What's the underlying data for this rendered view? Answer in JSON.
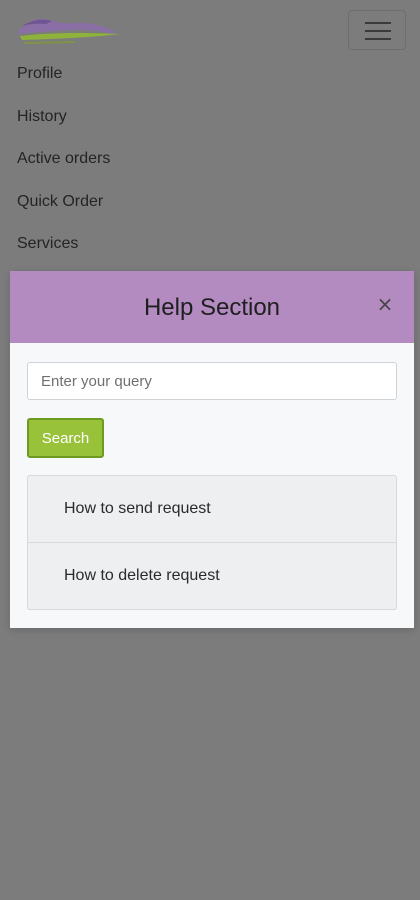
{
  "nav": {
    "items": [
      {
        "label": "Profile"
      },
      {
        "label": "History"
      },
      {
        "label": "Active orders"
      },
      {
        "label": "Quick Order"
      },
      {
        "label": "Services"
      }
    ]
  },
  "modal": {
    "title": "Help Section",
    "close_label": "×",
    "search": {
      "placeholder": "Enter your query",
      "value": "",
      "button_label": "Search"
    },
    "help_items": [
      {
        "label": "How to send request"
      },
      {
        "label": "How to delete request"
      }
    ]
  },
  "colors": {
    "overlay": "#7c7c7c",
    "modal_header": "#b38bc1",
    "search_button": "#99c23b"
  },
  "icons": {
    "logo": "brand-logo",
    "menu": "hamburger-menu-icon",
    "close": "close-icon"
  }
}
